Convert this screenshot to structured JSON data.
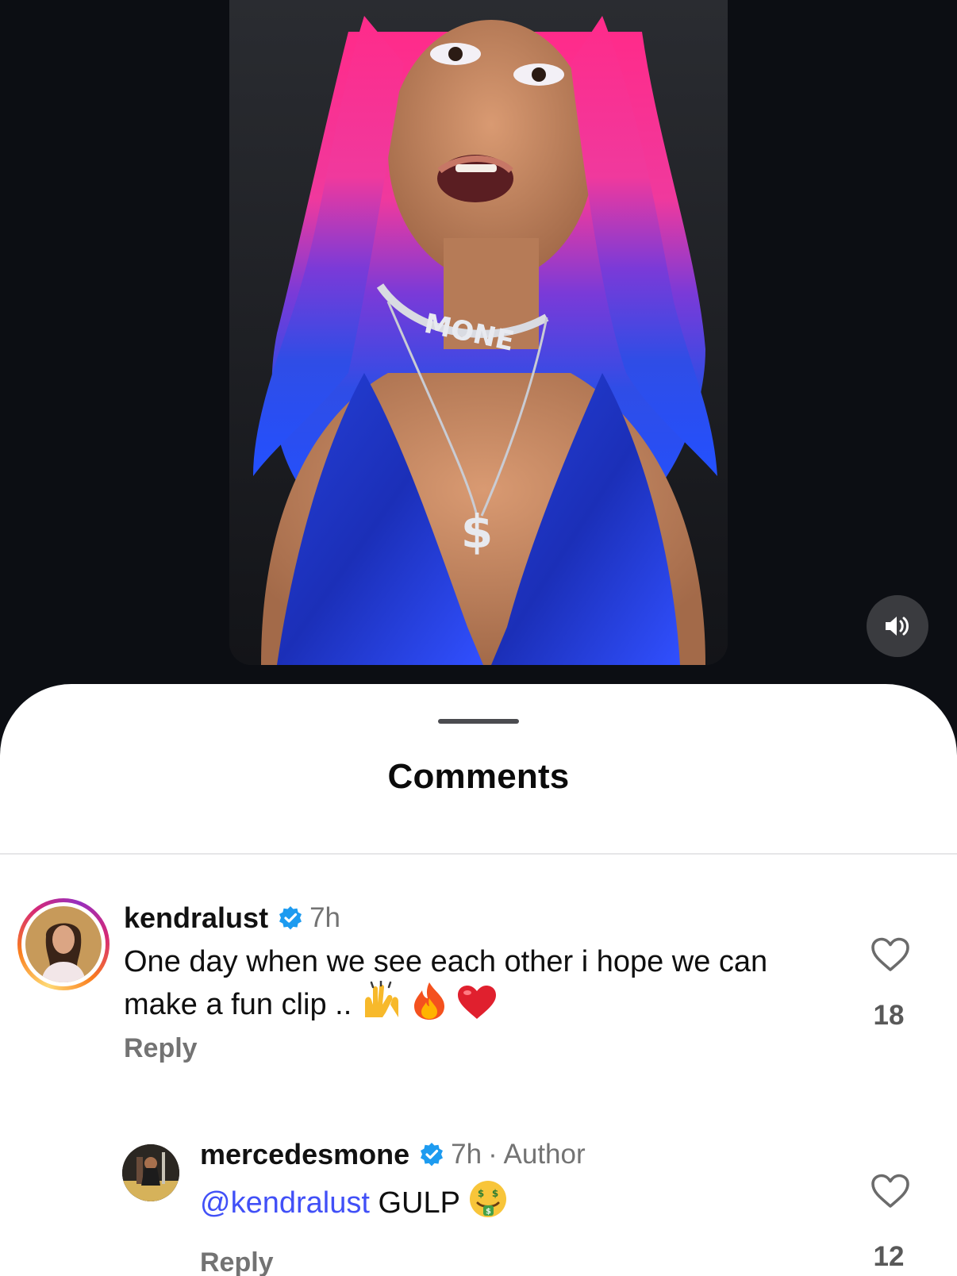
{
  "video": {
    "necklace_text": "MONE",
    "pendant_text": "$"
  },
  "mute_button": {
    "icon": "speaker-on-icon"
  },
  "sheet": {
    "title": "Comments"
  },
  "comments": [
    {
      "username": "kendralust",
      "verified": true,
      "time": "7h",
      "text": "One day when we see each other i hope we can make a fun clip ..",
      "emojis": [
        "raising-hands-icon",
        "fire-icon",
        "red-heart-icon"
      ],
      "reply_label": "Reply",
      "likes": "18"
    },
    {
      "username": "mercedesmone",
      "verified": true,
      "time": "7h",
      "author_tag": "· Author",
      "mention": "@kendralust",
      "text": "GULP",
      "emojis": [
        "money-mouth-face-icon"
      ],
      "reply_label": "Reply",
      "likes": "12"
    }
  ],
  "colors": {
    "verified_blue": "#1d9bf0",
    "mention_blue": "#4150f7",
    "secondary_text": "#737373"
  }
}
